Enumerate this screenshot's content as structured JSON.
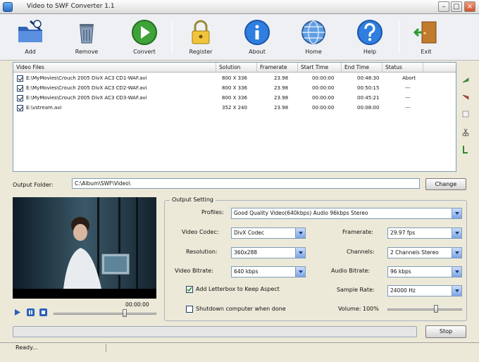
{
  "window": {
    "title": "Video to SWF Converter 1.1"
  },
  "toolbar": {
    "add": "Add",
    "remove": "Remove",
    "convert": "Convert",
    "register": "Register",
    "about": "About",
    "home": "Home",
    "help": "Help",
    "exit": "Exit"
  },
  "file_list": {
    "columns": [
      "Video Files",
      "Solution",
      "Framerate",
      "Start Time",
      "End Time",
      "Status"
    ],
    "rows": [
      {
        "file": "E:\\MyMovies\\Crouch 2005 DivX AC3 CD1-WAF.avi",
        "solution": "800 X 336",
        "framerate": "23.98",
        "start": "00:00:00",
        "end": "00:48:30",
        "status": "Abort"
      },
      {
        "file": "E:\\MyMovies\\Crouch 2005 DivX AC3 CD2-WAF.avi",
        "solution": "800 X 336",
        "framerate": "23.98",
        "start": "00:00:00",
        "end": "00:50:15",
        "status": "---"
      },
      {
        "file": "E:\\MyMovies\\Crouch 2005 DivX AC3 CD3-WAF.avi",
        "solution": "800 X 336",
        "framerate": "23.98",
        "start": "00:00:00",
        "end": "00:45:21",
        "status": "---"
      },
      {
        "file": "E:\\vstream.avi",
        "solution": "352 X 240",
        "framerate": "23.98",
        "start": "00:00:00",
        "end": "00:08:00",
        "status": "---"
      }
    ]
  },
  "output": {
    "label": "Output Folder:",
    "path": "C:\\Album\\SWF\\Video\\",
    "change": "Change"
  },
  "player": {
    "time": "00:00:00"
  },
  "settings": {
    "title": "Output Setting",
    "profiles_label": "Profiles:",
    "profiles_value": "Good Quality Video(640kbps) Audio 96kbps Stereo",
    "video_codec_label": "Video Codec:",
    "video_codec_value": "DivX Codec",
    "resolution_label": "Resolution:",
    "resolution_value": "360x288",
    "video_bitrate_label": "Video Bitrate:",
    "video_bitrate_value": "640 kbps",
    "framerate_label": "Framerate:",
    "framerate_value": "29.97 fps",
    "channels_label": "Channels:",
    "channels_value": "2 Channels Stereo",
    "audio_bitrate_label": "Audio Bitrate:",
    "audio_bitrate_value": "96 kbps",
    "sample_rate_label": "Sample Rate:",
    "sample_rate_value": "24000 Hz",
    "volume_label": "Volume: 100%",
    "volume_level": 0.65,
    "letterbox_label": "Add Letterbox to Keep Aspect",
    "shutdown_label": "Shutdown computer when done"
  },
  "bottom": {
    "stop": "Stop"
  },
  "statusbar": {
    "text": "Ready..."
  }
}
